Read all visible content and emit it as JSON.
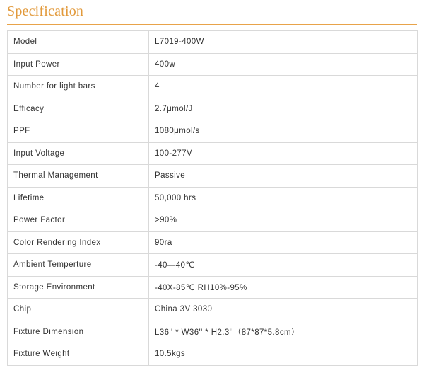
{
  "header": {
    "title": "Specification"
  },
  "spec_rows": [
    {
      "label": "Model",
      "value": "L7019-400W"
    },
    {
      "label": "Input Power",
      "value": "400w"
    },
    {
      "label": "Number for light bars",
      "value": "4"
    },
    {
      "label": "Efficacy",
      "value": "2.7μmol/J"
    },
    {
      "label": "PPF",
      "value": "1080μmol/s"
    },
    {
      "label": "Input Voltage",
      "value": "100-277V"
    },
    {
      "label": "Thermal Management",
      "value": "Passive"
    },
    {
      "label": "Lifetime",
      "value": "50,000 hrs"
    },
    {
      "label": "Power Factor",
      "value": ">90%"
    },
    {
      "label": "Color Rendering Index",
      "value": "90ra"
    },
    {
      "label": "Ambient Temperture",
      "value": "-40—40℃"
    },
    {
      "label": "Storage Environment",
      "value": "-40X-85℃ RH10%-95%"
    },
    {
      "label": "Chip",
      "value": "China 3V 3030"
    },
    {
      "label": "Fixture Dimension",
      "value": "L36'' * W36'' * H2.3''（87*87*5.8cm）"
    },
    {
      "label": "Fixture Weight",
      "value": "10.5kgs"
    }
  ],
  "colors": {
    "accent": "#e29a3c",
    "border": "#d9d9d9",
    "text": "#333333"
  }
}
